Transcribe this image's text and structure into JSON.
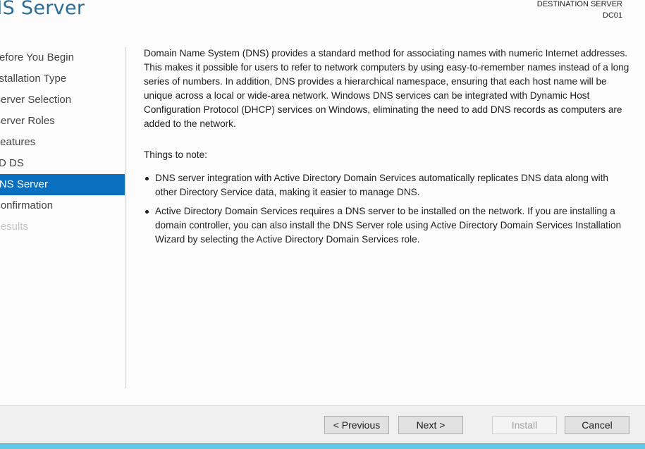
{
  "header": {
    "title": "DNS Server",
    "destination_label": "DESTINATION SERVER",
    "destination_value": "DC01"
  },
  "nav": {
    "items": [
      {
        "label": "Before You Begin",
        "state": "normal"
      },
      {
        "label": "Installation Type",
        "state": "normal"
      },
      {
        "label": "Server Selection",
        "state": "normal"
      },
      {
        "label": "Server Roles",
        "state": "normal"
      },
      {
        "label": "Features",
        "state": "normal"
      },
      {
        "label": "AD DS",
        "state": "normal"
      },
      {
        "label": "DNS Server",
        "state": "active"
      },
      {
        "label": "Confirmation",
        "state": "normal"
      },
      {
        "label": "Results",
        "state": "disabled"
      }
    ]
  },
  "content": {
    "intro": "Domain Name System (DNS) provides a standard method for associating names with numeric Internet addresses. This makes it possible for users to refer to network computers by using easy-to-remember names instead of a long series of numbers. In addition, DNS provides a hierarchical namespace, ensuring that each host name will be unique across a local or wide-area network. Windows DNS services can be integrated with Dynamic Host Configuration Protocol (DHCP) services on Windows, eliminating the need to add DNS records as computers are added to the network.",
    "notes_title": "Things to note:",
    "notes": [
      "DNS server integration with Active Directory Domain Services automatically replicates DNS data along with other Directory Service data, making it easier to manage DNS.",
      "Active Directory Domain Services requires a DNS server to be installed on the network. If you are installing a domain controller, you can also install the DNS Server role using Active Directory Domain Services Installation Wizard by selecting the Active Directory Domain Services role."
    ]
  },
  "footer": {
    "previous_label": "< Previous",
    "next_label": "Next >",
    "install_label": "Install",
    "cancel_label": "Cancel"
  },
  "colors": {
    "accent": "#0a6fbe",
    "title": "#2a6c93",
    "taskbar": "#62c8e8"
  }
}
